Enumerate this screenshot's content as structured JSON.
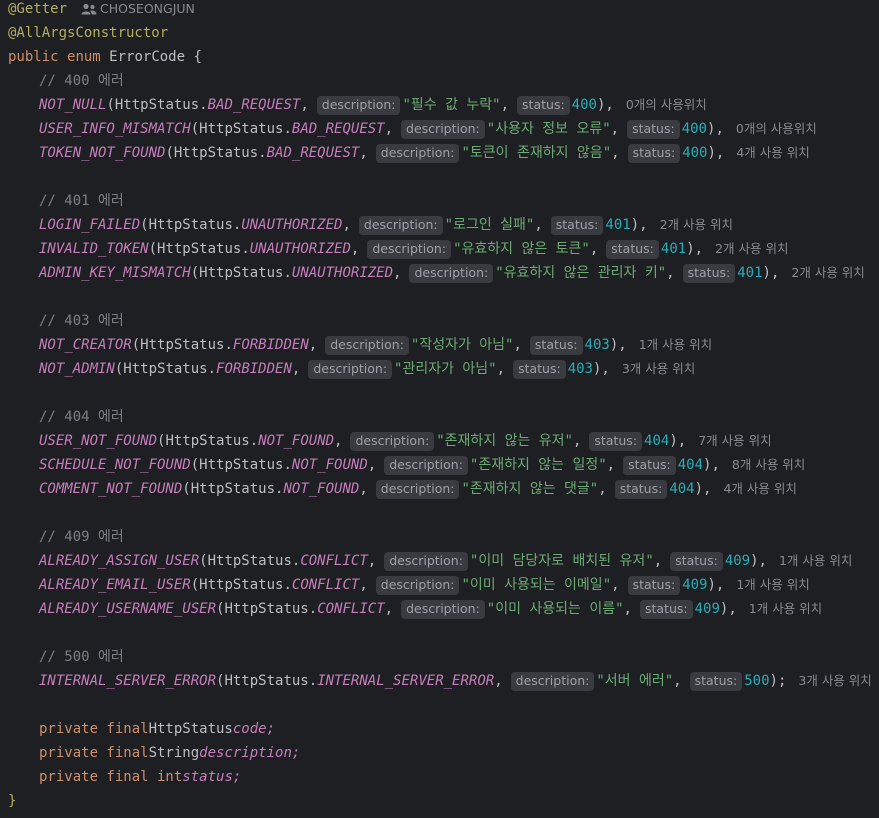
{
  "colors": {
    "background": "#1e1f22",
    "annotation": "#b3ae60",
    "keyword": "#cf8e6d",
    "constant": "#c77dbb",
    "string": "#6aab73",
    "number": "#2aacb8",
    "comment": "#7a7e85",
    "hint_background": "#393b40"
  },
  "header": {
    "getter_annotation": "@Getter",
    "author_icon": "people-icon",
    "author": "CHOSEONGJUN",
    "constructor_annotation": "@AllArgsConstructor",
    "decl_public": "public",
    "decl_enum": "enum",
    "decl_name": "ErrorCode",
    "decl_brace": "{"
  },
  "hint_labels": {
    "description": "description:",
    "status": "status:"
  },
  "http_status_class": "HttpStatus",
  "groups": [
    {
      "comment": "// 400 에러",
      "entries": [
        {
          "name": "NOT_NULL",
          "status_const": "BAD_REQUEST",
          "description": "\"필수 값 누락\"",
          "status": "400",
          "end": ",",
          "usage": "0개의 사용위치"
        },
        {
          "name": "USER_INFO_MISMATCH",
          "status_const": "BAD_REQUEST",
          "description": "\"사용자 정보 오류\"",
          "status": "400",
          "end": ",",
          "usage": "0개의 사용위치"
        },
        {
          "name": "TOKEN_NOT_FOUND",
          "status_const": "BAD_REQUEST",
          "description": "\"토큰이 존재하지 않음\"",
          "status": "400",
          "end": ",",
          "usage": "4개 사용 위치"
        }
      ]
    },
    {
      "comment": "// 401 에러",
      "entries": [
        {
          "name": "LOGIN_FAILED",
          "status_const": "UNAUTHORIZED",
          "description": "\"로그인 실패\"",
          "status": "401",
          "end": ",",
          "usage": "2개 사용 위치"
        },
        {
          "name": "INVALID_TOKEN",
          "status_const": "UNAUTHORIZED",
          "description": "\"유효하지 않은 토큰\"",
          "status": "401",
          "end": ",",
          "usage": "2개 사용 위치"
        },
        {
          "name": "ADMIN_KEY_MISMATCH",
          "status_const": "UNAUTHORIZED",
          "description": "\"유효하지 않은 관리자 키\"",
          "status": "401",
          "end": ",",
          "usage": "2개 사용 위치"
        }
      ]
    },
    {
      "comment": "// 403 에러",
      "entries": [
        {
          "name": "NOT_CREATOR",
          "status_const": "FORBIDDEN",
          "description": "\"작성자가 아님\"",
          "status": "403",
          "end": ",",
          "usage": "1개 사용 위치"
        },
        {
          "name": "NOT_ADMIN",
          "status_const": "FORBIDDEN",
          "description": "\"관리자가 아님\"",
          "status": "403",
          "end": ",",
          "usage": "3개 사용 위치"
        }
      ]
    },
    {
      "comment": "// 404 에러",
      "entries": [
        {
          "name": "USER_NOT_FOUND",
          "status_const": "NOT_FOUND",
          "description": "\"존재하지 않는 유저\"",
          "status": "404",
          "end": ",",
          "usage": "7개 사용 위치"
        },
        {
          "name": "SCHEDULE_NOT_FOUND",
          "status_const": "NOT_FOUND",
          "description": "\"존재하지 않는 일정\"",
          "status": "404",
          "end": ",",
          "usage": "8개 사용 위치"
        },
        {
          "name": "COMMENT_NOT_FOUND",
          "status_const": "NOT_FOUND",
          "description": "\"존재하지 않는 댓글\"",
          "status": "404",
          "end": ",",
          "usage": "4개 사용 위치"
        }
      ]
    },
    {
      "comment": "// 409 에러",
      "entries": [
        {
          "name": "ALREADY_ASSIGN_USER",
          "status_const": "CONFLICT",
          "description": "\"이미 담당자로 배치된 유저\"",
          "status": "409",
          "end": ",",
          "usage": "1개 사용 위치"
        },
        {
          "name": "ALREADY_EMAIL_USER",
          "status_const": "CONFLICT",
          "description": "\"이미 사용되는 이메일\"",
          "status": "409",
          "end": ",",
          "usage": "1개 사용 위치"
        },
        {
          "name": "ALREADY_USERNAME_USER",
          "status_const": "CONFLICT",
          "description": "\"이미 사용되는 이름\"",
          "status": "409",
          "end": ",",
          "usage": "1개 사용 위치"
        }
      ]
    },
    {
      "comment": "// 500 에러",
      "entries": [
        {
          "name": "INTERNAL_SERVER_ERROR",
          "status_const": "INTERNAL_SERVER_ERROR",
          "description": "\"서버 에러\"",
          "status": "500",
          "end": ";",
          "usage": "3개 사용 위치"
        }
      ]
    }
  ],
  "fields": [
    {
      "modifier": "private final",
      "type": "HttpStatus",
      "name": "code;"
    },
    {
      "modifier": "private final",
      "type": "String",
      "name": "description;"
    },
    {
      "modifier": "private final int",
      "type": "",
      "name": "status;"
    }
  ],
  "closing_brace": "}"
}
